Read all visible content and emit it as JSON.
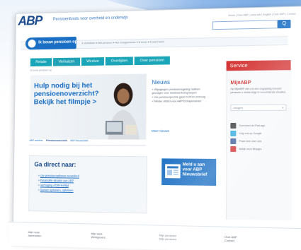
{
  "brand": {
    "logo": "ABP",
    "tagline": "Pensioenfonds voor overheid en onderwijs"
  },
  "toplinks": "Home | Over ABP | Lees ook | English | Over ABP | Contact",
  "search": {
    "button_label": "Q",
    "placeholder": ""
  },
  "ribbon": {
    "title": "Ik bouw pensioen op",
    "crumbs": "● Vertrekken  ● Met pensioen  ● Met vroegpensioen  ● Ik bouw  ● Ik word wees"
  },
  "nav": [
    "Relatie",
    "Verhuizen",
    "Werken",
    "Overlijden",
    "Over pensioen"
  ],
  "breadcrumb": "Ik bouw pensioen op",
  "hero": {
    "headline": "Hulp nodig bij het pensioenoverzicht? Bekijk het filmpje >",
    "tabs": [
      "ABP webinar",
      "Pensioenoverzicht",
      "ABP Nieuwsbrief"
    ]
  },
  "news": {
    "title": "Nieuws",
    "items": [
      "Wijzigingen pensioenregeling hebben gevolgen voor medewerkersgroepen",
      "Uw pensioenpremie gaat in 2014 omhoog",
      "Minder uitstel voor ABP Extrapensioen"
    ],
    "more": "Meer nieuws"
  },
  "service": {
    "title": "Service",
    "mijn_title": "MijnABP",
    "mijn_text": "Op MijnABP ziet u in een oogopslag hoeveel pensioen u straks krijgt in verschillende situaties.",
    "select_label": "Inloggen",
    "links": [
      {
        "label": "Download de iPad-app",
        "icon": "ipad-icon",
        "color": "#3a3a3a"
      },
      {
        "label": "Volg ons op Google",
        "icon": "twitter-icon",
        "color": "#2aa9e0"
      },
      {
        "label": "Praat mee over ons",
        "icon": "facebook-icon",
        "color": "#3b5998"
      },
      {
        "label": "Bekijk onze filmpjes",
        "icon": "youtube-icon",
        "color": "#d32f2f"
      }
    ]
  },
  "direct": {
    "title": "Ga direct naar:",
    "links": [
      "Uw pensioenopbouw veranderd",
      "Financiële situatie van ABP",
      "Verhoging AOW-leeftijd",
      "Samen oplossen, oplossen"
    ]
  },
  "newsletter": {
    "text": "Meld u aan voor ABP Nieuwsbrief"
  },
  "footer": [
    {
      "line1": "Mijn route",
      "line2": "Aanmelden"
    },
    {
      "line1": "Mijn werk",
      "line2": "Werkgevers"
    },
    {
      "line1": "Mijn pensioen",
      "line2": "Mijn pensioen"
    },
    {
      "line1": "Over ABP",
      "line2": "Contact"
    }
  ]
}
